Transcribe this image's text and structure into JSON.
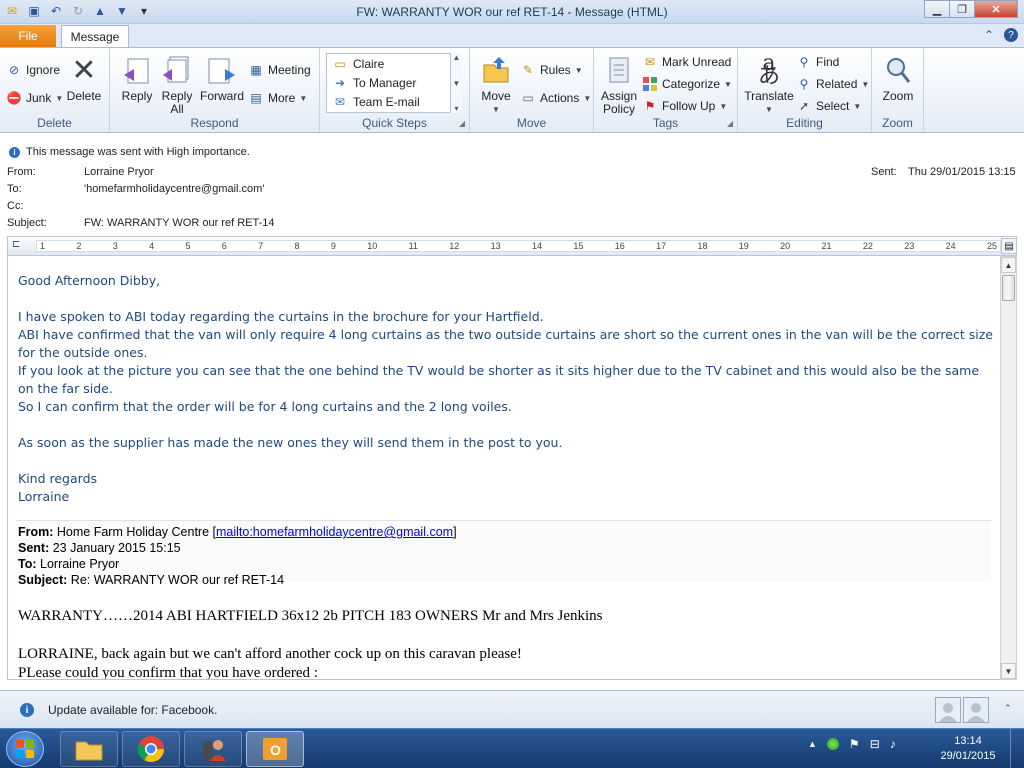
{
  "window": {
    "title": "FW: WARRANTY WOR our ref RET-14  -  Message (HTML)"
  },
  "tabs": {
    "file": "File",
    "message": "Message"
  },
  "ribbon": {
    "delete": {
      "ignore": "Ignore",
      "junk": "Junk",
      "delete": "Delete",
      "label": "Delete"
    },
    "respond": {
      "reply": "Reply",
      "reply_all_1": "Reply",
      "reply_all_2": "All",
      "forward": "Forward",
      "meeting": "Meeting",
      "more": "More",
      "label": "Respond"
    },
    "quick_steps": {
      "items": [
        "Claire",
        "To Manager",
        "Team E-mail"
      ],
      "label": "Quick Steps"
    },
    "move": {
      "move": "Move",
      "rules": "Rules",
      "actions": "Actions",
      "label": "Move"
    },
    "tags": {
      "assign_1": "Assign",
      "assign_2": "Policy",
      "mark_unread": "Mark Unread",
      "categorize": "Categorize",
      "follow_up": "Follow Up",
      "label": "Tags"
    },
    "editing": {
      "translate": "Translate",
      "find": "Find",
      "related": "Related",
      "select": "Select",
      "label": "Editing"
    },
    "zoom": {
      "zoom": "Zoom",
      "label": "Zoom"
    }
  },
  "header": {
    "importance": "This message was sent with High importance.",
    "from_label": "From:",
    "from": "Lorraine Pryor",
    "to_label": "To:",
    "to": "'homefarmholidaycentre@gmail.com'",
    "cc_label": "Cc:",
    "subject_label": "Subject:",
    "subject": "FW: WARRANTY WOR our ref RET-14",
    "sent_label": "Sent:",
    "sent": "Thu 29/01/2015 13:15"
  },
  "ruler": [
    "1",
    "2",
    "3",
    "4",
    "5",
    "6",
    "7",
    "8",
    "9",
    "10",
    "11",
    "12",
    "13",
    "14",
    "15",
    "16",
    "17",
    "18",
    "19",
    "20",
    "21",
    "22",
    "23",
    "24",
    "25"
  ],
  "body": {
    "greeting": "Good Afternoon Dibby,",
    "p1": "I have spoken to ABI today regarding the curtains in the brochure for your Hartfield.",
    "p2": "ABI have confirmed that the van will only require 4 long curtains as the two outside curtains are short so the current ones in the van will be the correct size for the outside ones.",
    "p3": "If you look at the picture you can see that the one behind the TV would be shorter as it sits higher due to the TV cabinet and this would also be the same on the far side.",
    "p4": "So I can confirm that the order will be for 4 long curtains and the 2 long voiles.",
    "p5": "As soon as the supplier has made the new ones they will send them in the post to you.",
    "sign1": "Kind regards",
    "sign2": "Lorraine"
  },
  "forwarded": {
    "from_label": "From:",
    "from": "Home Farm Holiday Centre [",
    "from_link": "mailto:homefarmholidaycentre@gmail.com",
    "from_close": "]",
    "sent_label": "Sent:",
    "sent": "23 January 2015 15:15",
    "to_label": "To:",
    "to": "Lorraine Pryor",
    "subject_label": "Subject:",
    "subject": "Re: WARRANTY WOR our ref RET-14",
    "line1": "WARRANTY……2014 ABI HARTFIELD  36x12 2b PITCH 183 OWNERS Mr and Mrs  Jenkins",
    "line2": "LORRAINE, back again but we can't afford another cock up on this caravan please!",
    "line3": "PLease could you confirm that you have ordered :"
  },
  "status": {
    "update": "Update available for: Facebook."
  },
  "taskbar": {
    "time": "13:14",
    "date": "29/01/2015"
  }
}
